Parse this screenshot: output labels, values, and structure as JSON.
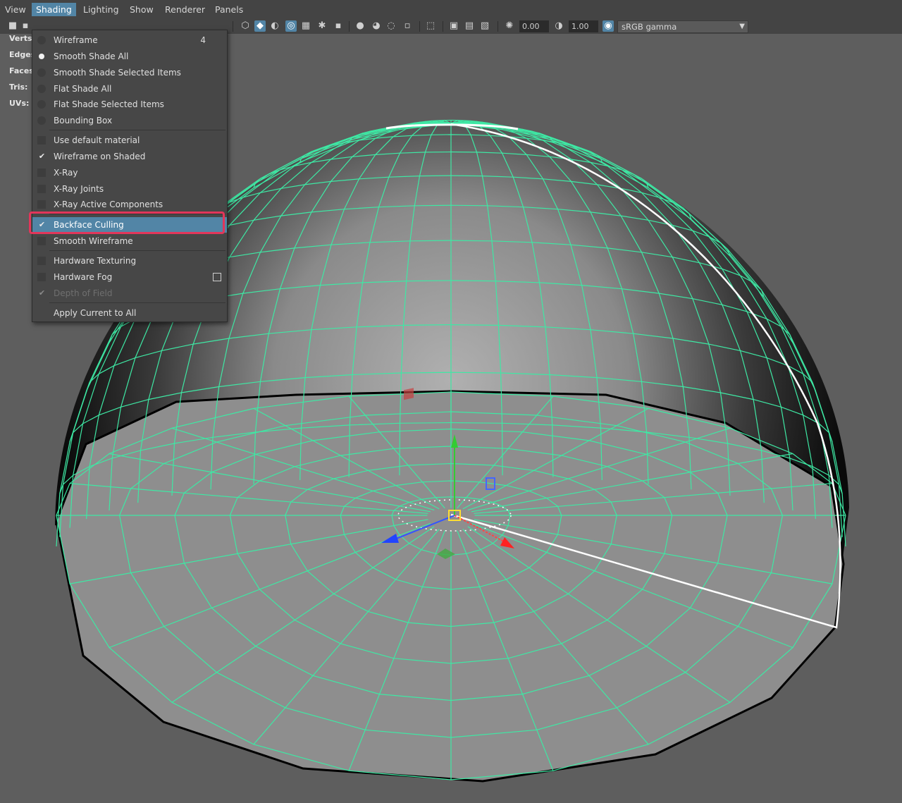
{
  "menubar": {
    "items": [
      "View",
      "Shading",
      "Lighting",
      "Show",
      "Renderer",
      "Panels"
    ],
    "active": "Shading"
  },
  "toolbar": {
    "exposure_value": "0.00",
    "gamma_value": "1.00",
    "color_space": "sRGB gamma"
  },
  "hud": {
    "labels": [
      "Verts:",
      "Edges:",
      "Faces:",
      "Tris:",
      "UVs:"
    ]
  },
  "shading_menu": {
    "wireframe": {
      "label": "Wireframe",
      "shortcut": "4"
    },
    "smooth_shade_all": {
      "label": "Smooth Shade All",
      "selected": true
    },
    "smooth_shade_selected": {
      "label": "Smooth Shade Selected Items"
    },
    "flat_shade_all": {
      "label": "Flat Shade All"
    },
    "flat_shade_selected": {
      "label": "Flat Shade Selected Items"
    },
    "bounding_box": {
      "label": "Bounding Box"
    },
    "use_default_material": {
      "label": "Use default material",
      "checked": false
    },
    "wireframe_on_shaded": {
      "label": "Wireframe on Shaded",
      "checked": true
    },
    "xray": {
      "label": "X-Ray",
      "checked": false
    },
    "xray_joints": {
      "label": "X-Ray Joints",
      "checked": false
    },
    "xray_active_components": {
      "label": "X-Ray Active Components",
      "checked": false
    },
    "backface_culling": {
      "label": "Backface Culling",
      "checked": true,
      "highlighted": true
    },
    "smooth_wireframe": {
      "label": "Smooth Wireframe",
      "checked": false
    },
    "hardware_texturing": {
      "label": "Hardware Texturing",
      "checked": false
    },
    "hardware_fog": {
      "label": "Hardware Fog",
      "checked": false
    },
    "depth_of_field": {
      "label": "Depth of Field",
      "checked": true,
      "disabled": true
    },
    "apply_current_to_all": {
      "label": "Apply Current to All"
    }
  },
  "colors": {
    "menu_highlight": "#5285a6",
    "annotation_box": "#e2365a",
    "wireframe": "#3ee8a4",
    "selected_edge": "#ffffff"
  }
}
